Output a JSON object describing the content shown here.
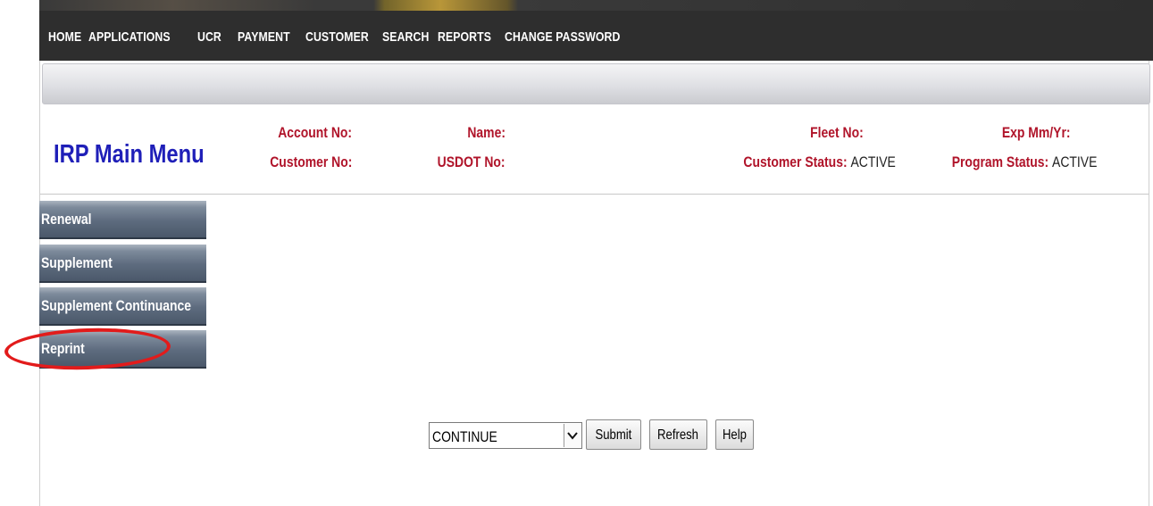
{
  "nav": {
    "items": [
      "HOME",
      "APPLICATIONS",
      "UCR",
      "PAYMENT",
      "CUSTOMER",
      "SEARCH",
      "REPORTS",
      "CHANGE PASSWORD"
    ]
  },
  "header": {
    "title": "IRP Main Menu",
    "account_no_label": "Account No:",
    "customer_no_label": "Customer No:",
    "name_label": "Name:",
    "usdot_no_label": "USDOT No:",
    "fleet_no_label": "Fleet No:",
    "customer_status_label": "Customer Status:",
    "customer_status_value": "ACTIVE",
    "exp_label": "Exp Mm/Yr:",
    "program_status_label": "Program Status:",
    "program_status_value": "ACTIVE"
  },
  "sidebar": {
    "items": [
      {
        "label": "Renewal"
      },
      {
        "label": "Supplement"
      },
      {
        "label": "Supplement Continuance"
      },
      {
        "label": "Reprint"
      }
    ]
  },
  "form": {
    "select_value": "CONTINUE",
    "submit_label": "Submit",
    "refresh_label": "Refresh",
    "help_label": "Help"
  },
  "colors": {
    "nav_bg": "#2e2e2e",
    "title_blue": "#1f1fb8",
    "label_red": "#b0142a",
    "menu_steel": "#5d6b7e",
    "annotation_red": "#e21b1b"
  },
  "icons": [
    "chevron-down-icon"
  ]
}
